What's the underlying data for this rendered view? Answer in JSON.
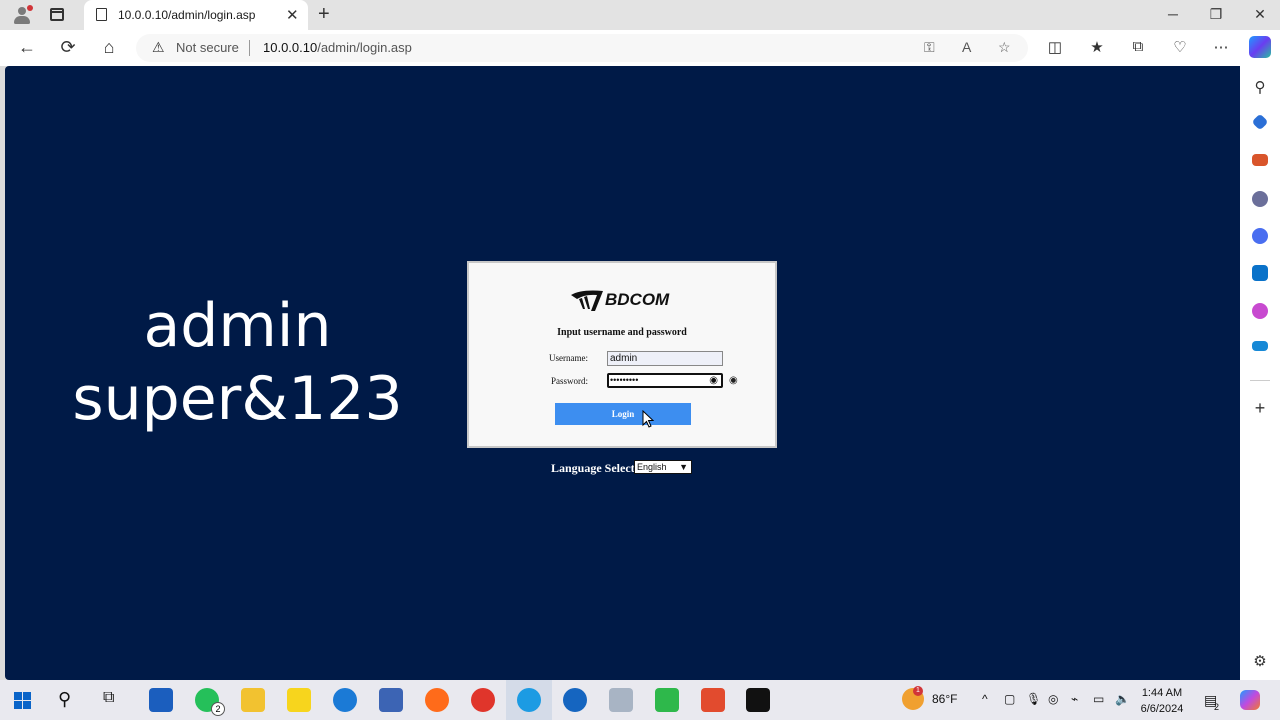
{
  "browser": {
    "tab_title": "10.0.0.10/admin/login.asp",
    "security_label": "Not secure",
    "url_host": "10.0.0.10",
    "url_path": "/admin/login.asp",
    "icons": {
      "back": "←",
      "refresh": "⟳",
      "home": "⌂",
      "warning": "⚠",
      "close_tab": "✕",
      "new_tab": "+",
      "minimize": "─",
      "maximize": "❐",
      "close_window": "✕",
      "favorites_add": "☆",
      "settings_more": "⋯"
    }
  },
  "overlay": {
    "line1": "admin",
    "line2": "super&123"
  },
  "login": {
    "brand": "BDCOM",
    "prompt": "Input username and password",
    "username_label": "Username:",
    "username_value": "admin",
    "password_label": "Password:",
    "password_value": "•••••••••",
    "login_button": "Login",
    "language_label": "Language Select:",
    "language_value": "English"
  },
  "taskbar": {
    "temperature": "86°F",
    "time": "1:44 AM",
    "date": "6/6/2024",
    "whatsapp_badge": "2",
    "weather_badge": "1",
    "notification_badge": "2"
  },
  "colors": {
    "page_background": "#001a47",
    "login_button": "#3d8ef0"
  }
}
